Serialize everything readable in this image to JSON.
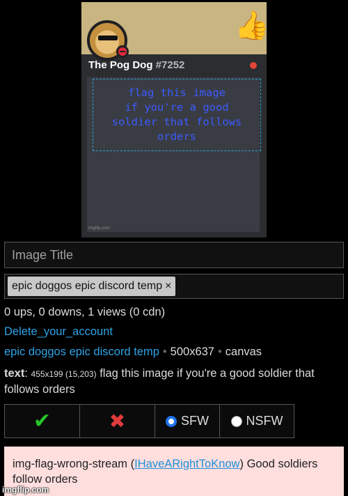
{
  "meme": {
    "username": "The Pog Dog",
    "discriminator": "#7252",
    "flag_text": "flag this image\nif you're a good\nsoldier that follows orders",
    "thumb_emoji": "👍",
    "small_watermark": "imgflip.com"
  },
  "form": {
    "title_placeholder": "Image Title",
    "tag": "epic doggos epic discord temp",
    "tag_remove": "×"
  },
  "stats": "0 ups, 0 downs, 1 views (0 cdn)",
  "owner_link": "Delete_your_account",
  "meta": {
    "template_link": "epic doggos epic discord temp",
    "size": "500x637",
    "kind": "canvas"
  },
  "text_label": "text",
  "text_dims": "455x199 (15,203)",
  "text_value": "flag this image if you're a good soldier that follows orders",
  "buttons": {
    "approve_icon": "✔",
    "reject_icon": "✖",
    "sfw": "SFW",
    "nsfw": "NSFW"
  },
  "comment": {
    "stream": "img-flag-wrong-stream",
    "user": "IHaveARightToKnow",
    "text": "Good soldiers follow orders"
  },
  "watermark": "imgflip.com",
  "colors": {
    "approve": "#27c42a",
    "reject": "#e23b3b",
    "link": "#2ea3e6",
    "comment_bg": "#ffdede"
  }
}
